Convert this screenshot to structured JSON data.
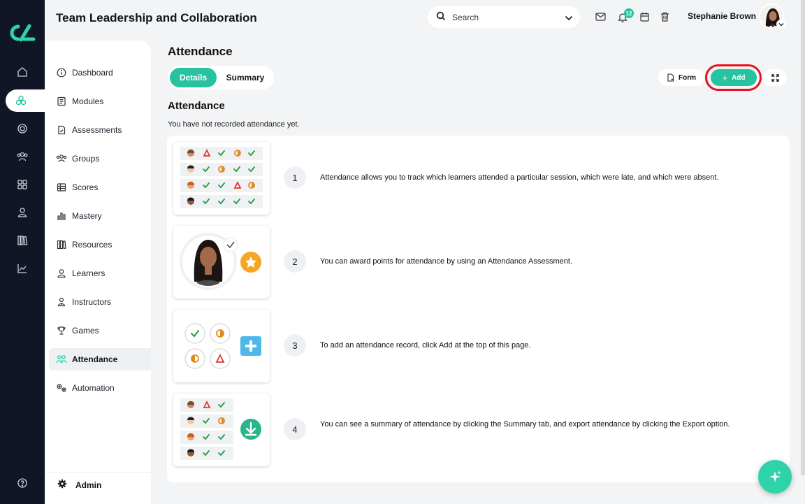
{
  "header": {
    "title": "Team Leadership and Collaboration",
    "search_placeholder": "Search",
    "notification_count": "12",
    "user_name": "Stephanie Brown"
  },
  "sidebar": {
    "items": [
      {
        "label": "Dashboard",
        "icon": "info-circle-icon"
      },
      {
        "label": "Modules",
        "icon": "book-icon"
      },
      {
        "label": "Assessments",
        "icon": "document-check-icon"
      },
      {
        "label": "Groups",
        "icon": "group-icon"
      },
      {
        "label": "Scores",
        "icon": "table-icon"
      },
      {
        "label": "Mastery",
        "icon": "bar-chart-icon"
      },
      {
        "label": "Resources",
        "icon": "library-icon"
      },
      {
        "label": "Learners",
        "icon": "user-icon"
      },
      {
        "label": "Instructors",
        "icon": "instructor-icon"
      },
      {
        "label": "Games",
        "icon": "trophy-icon"
      },
      {
        "label": "Attendance",
        "icon": "attendance-icon",
        "active": true
      },
      {
        "label": "Automation",
        "icon": "gears-icon"
      }
    ],
    "admin_label": "Admin"
  },
  "main": {
    "page_title": "Attendance",
    "tabs": [
      {
        "label": "Details",
        "active": true
      },
      {
        "label": "Summary",
        "active": false
      }
    ],
    "form_label": "Form",
    "add_label": "Add",
    "section_title": "Attendance",
    "empty_note": "You have not recorded attendance yet.",
    "steps": [
      {
        "number": "1",
        "text": "Attendance allows you to track which learners attended a particular session, which were late, and which were absent."
      },
      {
        "number": "2",
        "text": "You can award points for attendance by using an Attendance Assessment."
      },
      {
        "number": "3",
        "text": "To add an attendance record, click Add at the top of this page."
      },
      {
        "number": "4",
        "text": "You can see a summary of attendance by clicking the Summary tab, and export attendance by clicking the Export option."
      }
    ]
  },
  "colors": {
    "accent": "#27c3a0",
    "rail": "#101626",
    "highlight_ring": "#e8101b",
    "present": "#1f9d3a",
    "late": "#e08a1e",
    "absent": "#e03a2a"
  }
}
